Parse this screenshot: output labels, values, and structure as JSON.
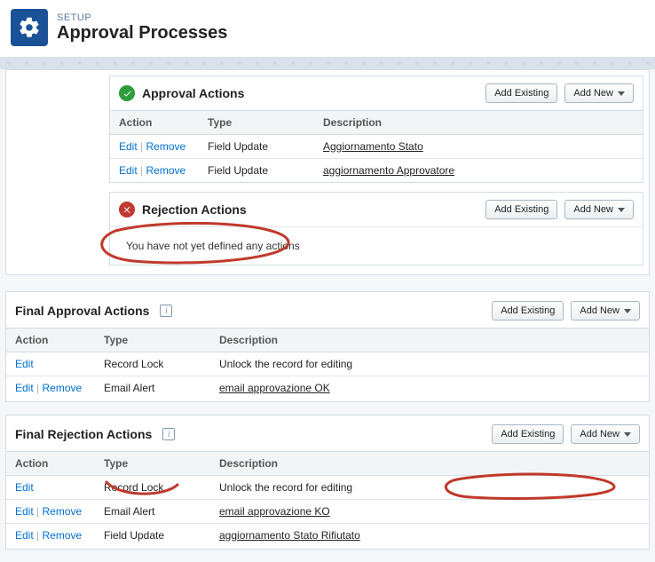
{
  "header": {
    "eyebrow": "SETUP",
    "title": "Approval Processes"
  },
  "common": {
    "addExisting": "Add Existing",
    "addNew": "Add New",
    "edit": "Edit",
    "remove": "Remove",
    "cols": {
      "action": "Action",
      "type": "Type",
      "desc": "Description"
    }
  },
  "approvalActions": {
    "title": "Approval Actions",
    "rows": [
      {
        "type": "Field Update",
        "desc": "Aggiornamento Stato"
      },
      {
        "type": "Field Update",
        "desc": "aggiornamento Approvatore"
      }
    ]
  },
  "rejectionActions": {
    "title": "Rejection Actions",
    "empty": "You have not yet defined any actions"
  },
  "finalApproval": {
    "title": "Final Approval Actions",
    "rows": [
      {
        "type": "Record Lock",
        "desc": "Unlock the record for editing",
        "editOnly": true,
        "descLink": false
      },
      {
        "type": "Email Alert",
        "desc": "email approvazione OK",
        "editOnly": false,
        "descLink": true
      }
    ]
  },
  "finalRejection": {
    "title": "Final Rejection Actions",
    "rows": [
      {
        "type": "Record Lock",
        "desc": "Unlock the record for editing",
        "editOnly": true,
        "descLink": false
      },
      {
        "type": "Email Alert",
        "desc": "email approvazione KO",
        "editOnly": false,
        "descLink": true
      },
      {
        "type": "Field Update",
        "desc": "aggiornamento Stato Rifiutato",
        "editOnly": false,
        "descLink": true
      }
    ]
  }
}
